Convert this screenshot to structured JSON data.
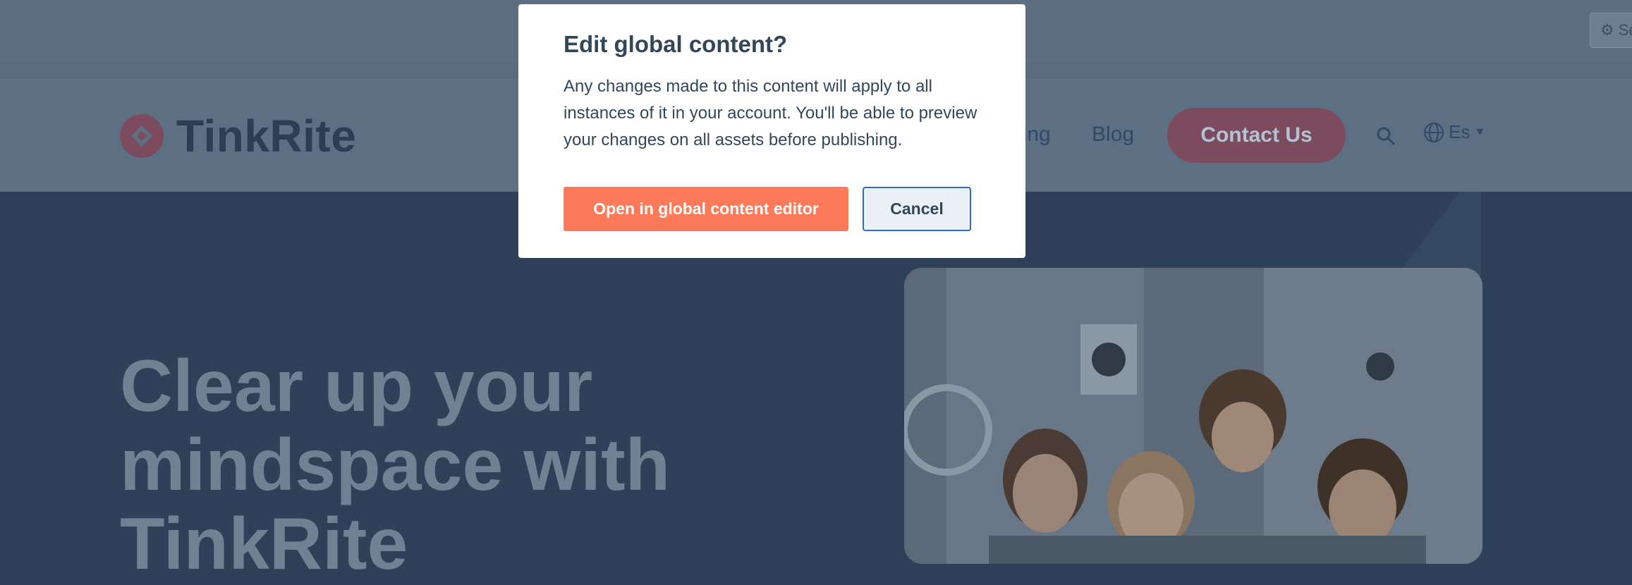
{
  "topbar": {
    "settings_label": "Se"
  },
  "header": {
    "brand": "TinkRite",
    "nav": {
      "pricing": "icing",
      "blog": "Blog"
    },
    "contact_label": "Contact Us",
    "language": "Es"
  },
  "hero": {
    "title": "Clear up your mindspace with TinkRite"
  },
  "modal": {
    "title": "Edit global content?",
    "body": "Any changes made to this content will apply to all instances of it in your account. You'll be able to preview your changes on all assets before publishing.",
    "primary_label": "Open in global content editor",
    "cancel_label": "Cancel"
  },
  "colors": {
    "accent": "#ff7a59",
    "brand_red": "#7c4c5e",
    "text_dark": "#33475b",
    "cancel_border": "#2e6fb6"
  },
  "icons": [
    "gear-icon",
    "search-icon",
    "globe-icon",
    "caret-down-icon",
    "tinkrite-logo-icon"
  ]
}
